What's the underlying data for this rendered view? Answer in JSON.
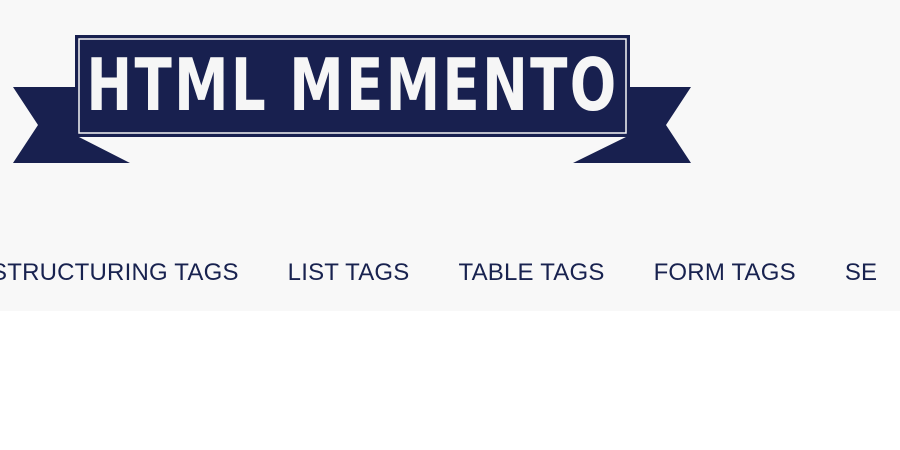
{
  "colors": {
    "header_bg": "#f8f8f8",
    "brand_navy": "#18204f",
    "logo_text": "#f6f6f6",
    "nav_text": "#18224f",
    "page_bg": "#ffffff"
  },
  "logo": {
    "text": "HTML MEMENTO",
    "icon": "ribbon-banner-logo"
  },
  "nav": {
    "items": [
      {
        "label": "STRUCTURING TAGS"
      },
      {
        "label": "LIST TAGS"
      },
      {
        "label": "TABLE TAGS"
      },
      {
        "label": "FORM TAGS"
      },
      {
        "label": "SE"
      }
    ]
  }
}
